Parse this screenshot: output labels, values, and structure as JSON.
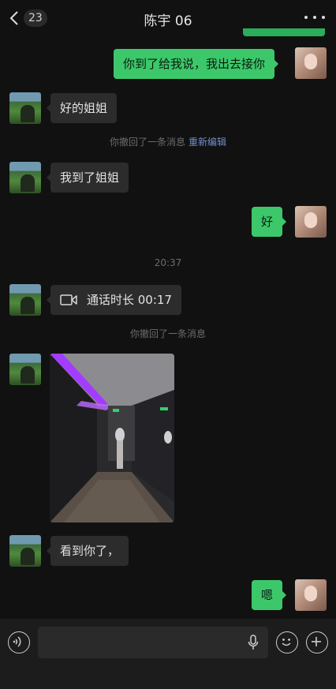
{
  "header": {
    "unread_count": "23",
    "title": "陈宇 06",
    "back_icon": "chevron-left-icon",
    "more_icon": "more-dots-icon"
  },
  "messages": {
    "m1": "你到了给我说，我出去接你",
    "m2": "好的姐姐",
    "recall1": "你撤回了一条消息",
    "recall1_link": "重新编辑",
    "m3": "我到了姐姐",
    "m4": "好",
    "time1": "20:37",
    "call": "通话时长 00:17",
    "recall2": "你撤回了一条消息",
    "m5": "看到你了，",
    "m6": "嗯"
  },
  "composer": {
    "voice_icon": "voice-icon",
    "mic_icon": "microphone-icon",
    "emoji_icon": "emoji-icon",
    "plus_icon": "plus-icon"
  },
  "colors": {
    "background": "#111111",
    "outgoing_bubble": "#3cc86a",
    "incoming_bubble": "#2c2c2c",
    "link": "#6f8fc9"
  }
}
